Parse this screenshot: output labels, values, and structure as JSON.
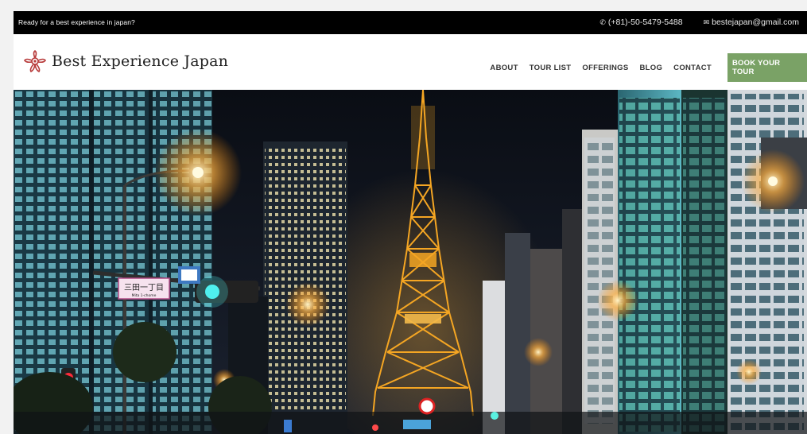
{
  "topbar": {
    "tagline": "Ready for a best experience in japan?",
    "phone": "(+81)-50-5479-5488",
    "email": "bestejapan@gmail.com",
    "phone_icon": "phone-icon",
    "email_icon": "envelope-icon"
  },
  "header": {
    "site_name": "Best Experience Japan",
    "logo_icon": "flower-logo-icon"
  },
  "nav": {
    "items": [
      "ABOUT",
      "TOUR LIST",
      "OFFERINGS",
      "BLOG",
      "CONTACT"
    ],
    "cta": "BOOK YOUR TOUR",
    "cta_color": "#7aa266"
  },
  "hero": {
    "sign_main": "三田一丁目",
    "sign_sub": "Mita 1-chome",
    "tower_color": "#f5a623"
  }
}
